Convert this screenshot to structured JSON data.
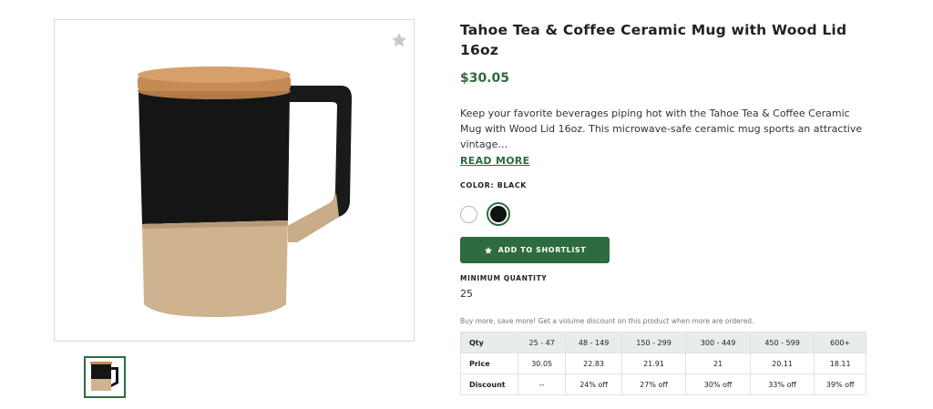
{
  "product": {
    "title": "Tahoe Tea & Coffee Ceramic Mug with Wood Lid 16oz",
    "price": "$30.05",
    "description": "Keep your favorite beverages piping hot with the Tahoe Tea & Coffee Ceramic Mug with Wood Lid 16oz. This microwave-safe ceramic mug sports an attractive vintage…",
    "read_more": "READ MORE",
    "color_label": "COLOR: BLACK",
    "colors": [
      "#ffffff",
      "#111111"
    ],
    "selected_color": "#111111",
    "shortlist_label": "ADD TO SHORTLIST",
    "min_qty_label": "MINIMUM QUANTITY",
    "min_qty_value": "25",
    "volume_note": "Buy more, save more! Get a volume discount on this product when more are ordered."
  },
  "pricing": {
    "headers": [
      "Qty",
      "25 - 47",
      "48 - 149",
      "150 - 299",
      "300 - 449",
      "450 - 599",
      "600+"
    ],
    "price_row": [
      "Price",
      "30.05",
      "22.83",
      "21.91",
      "21",
      "20.11",
      "18.11"
    ],
    "discount_row": [
      "Discount",
      "--",
      "24% off",
      "27% off",
      "30% off",
      "33% off",
      "39% off"
    ]
  },
  "icons": {
    "favorite": "star-icon",
    "shortlist": "star-icon"
  },
  "colors": {
    "accent": "#2e6b3e",
    "table_header_bg": "#e7ede8"
  }
}
